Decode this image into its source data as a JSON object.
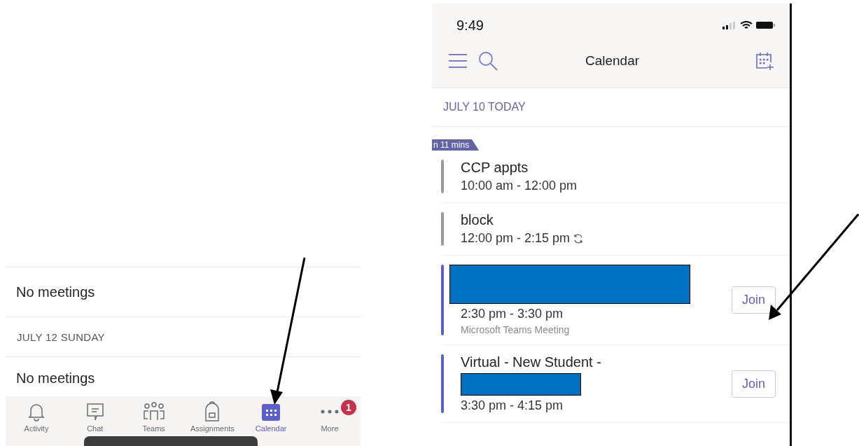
{
  "left_screen": {
    "list": [
      {
        "kind": "empty",
        "text": "No meetings"
      },
      {
        "kind": "header",
        "text": "JULY 12  SUNDAY"
      },
      {
        "kind": "empty",
        "text": "No meetings"
      }
    ],
    "tab_bar": [
      {
        "label": "Activity",
        "selected": false
      },
      {
        "label": "Chat",
        "selected": false
      },
      {
        "label": "Teams",
        "selected": false
      },
      {
        "label": "Assignments",
        "selected": false
      },
      {
        "label": "Calendar",
        "selected": true
      },
      {
        "label": "More",
        "selected": false,
        "badge": "1"
      }
    ]
  },
  "right_screen": {
    "status_bar": {
      "time": "9:49"
    },
    "header": {
      "title": "Calendar"
    },
    "date_header": "JULY 10  TODAY",
    "upcoming_badge": "n 11 mins",
    "events": [
      {
        "title": "CCP appts",
        "redacted": false,
        "time": "10:00 am - 12:00 pm",
        "recurring": false,
        "color": "#9a9a9a"
      },
      {
        "title": "block",
        "redacted": false,
        "time": "12:00 pm - 2:15 pm",
        "recurring": true,
        "color": "#9a9a9a"
      },
      {
        "redacted": true,
        "time": "2:30 pm - 3:30 pm",
        "subtitle": "Microsoft Teams Meeting",
        "recurring": false,
        "color": "#5b5fc7",
        "button": "Join"
      },
      {
        "title": "Virtual - New Student  -",
        "redacted": true,
        "time": "3:30 pm - 4:15 pm",
        "recurring": false,
        "color": "#5b5fc7",
        "button": "Join"
      }
    ]
  }
}
